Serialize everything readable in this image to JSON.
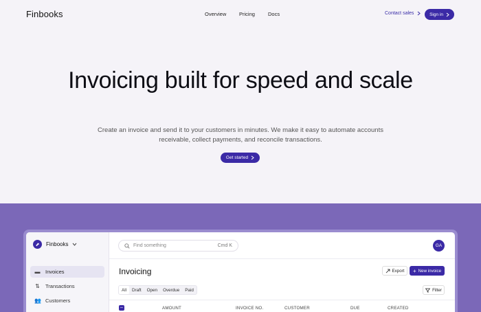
{
  "nav": {
    "logo": "Finbooks",
    "links": [
      "Overview",
      "Pricing",
      "Docs"
    ],
    "contact_sales": "Contact sales",
    "sign_in": "Sign in"
  },
  "hero": {
    "title": "Invoicing built for speed and scale",
    "subtitle": "Create an invoice and send it to your customers in minutes. We make it easy to automate accounts receivable, collect payments, and reconcile transactions.",
    "cta": "Get started"
  },
  "app": {
    "workspace": "Finbooks",
    "sidebar": [
      {
        "label": "Invoices",
        "icon": "invoice-icon",
        "active": true
      },
      {
        "label": "Transactions",
        "icon": "transactions-icon",
        "active": false
      },
      {
        "label": "Customers",
        "icon": "customers-icon",
        "active": false
      }
    ],
    "search": {
      "placeholder": "Find something",
      "shortcut": "Cmd K"
    },
    "avatar": "GA",
    "page_title": "Invoicing",
    "export": "Export",
    "new_invoice": "New invoice",
    "tabs": [
      "All",
      "Draft",
      "Open",
      "Overdue",
      "Paid"
    ],
    "active_tab": "All",
    "filter": "Filter",
    "columns": [
      "AMOUNT",
      "INVOICE NO.",
      "CUSTOMER",
      "DUE",
      "CREATED"
    ]
  },
  "colors": {
    "brand": "#3b2aa6",
    "band": "#7b68b8",
    "background": "#f5f3f8"
  }
}
